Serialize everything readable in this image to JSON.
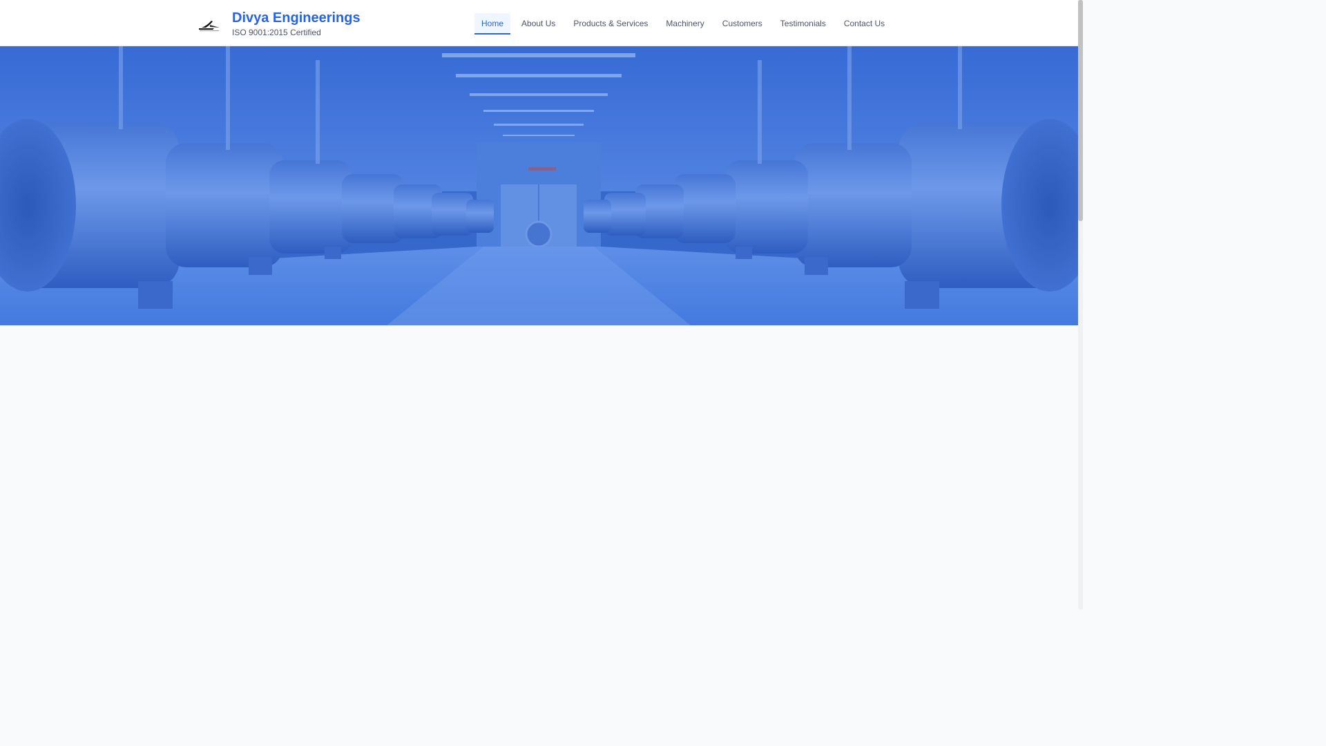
{
  "brand": {
    "title": "Divya Engineerings",
    "subtitle": "ISO 9001:2015 Certified",
    "logo_icon": "company-logo-icon",
    "accent_color": "#2563eb"
  },
  "nav": {
    "items": [
      {
        "label": "Home",
        "active": true
      },
      {
        "label": "About Us",
        "active": false
      },
      {
        "label": "Products & Services",
        "active": false
      },
      {
        "label": "Machinery",
        "active": false
      },
      {
        "label": "Customers",
        "active": false
      },
      {
        "label": "Testimonials",
        "active": false
      },
      {
        "label": "Contact Us",
        "active": false
      }
    ]
  },
  "hero": {
    "image": "industrial-hall-with-blue-pipeline-tanks",
    "overlay_color": "#2563eb"
  }
}
